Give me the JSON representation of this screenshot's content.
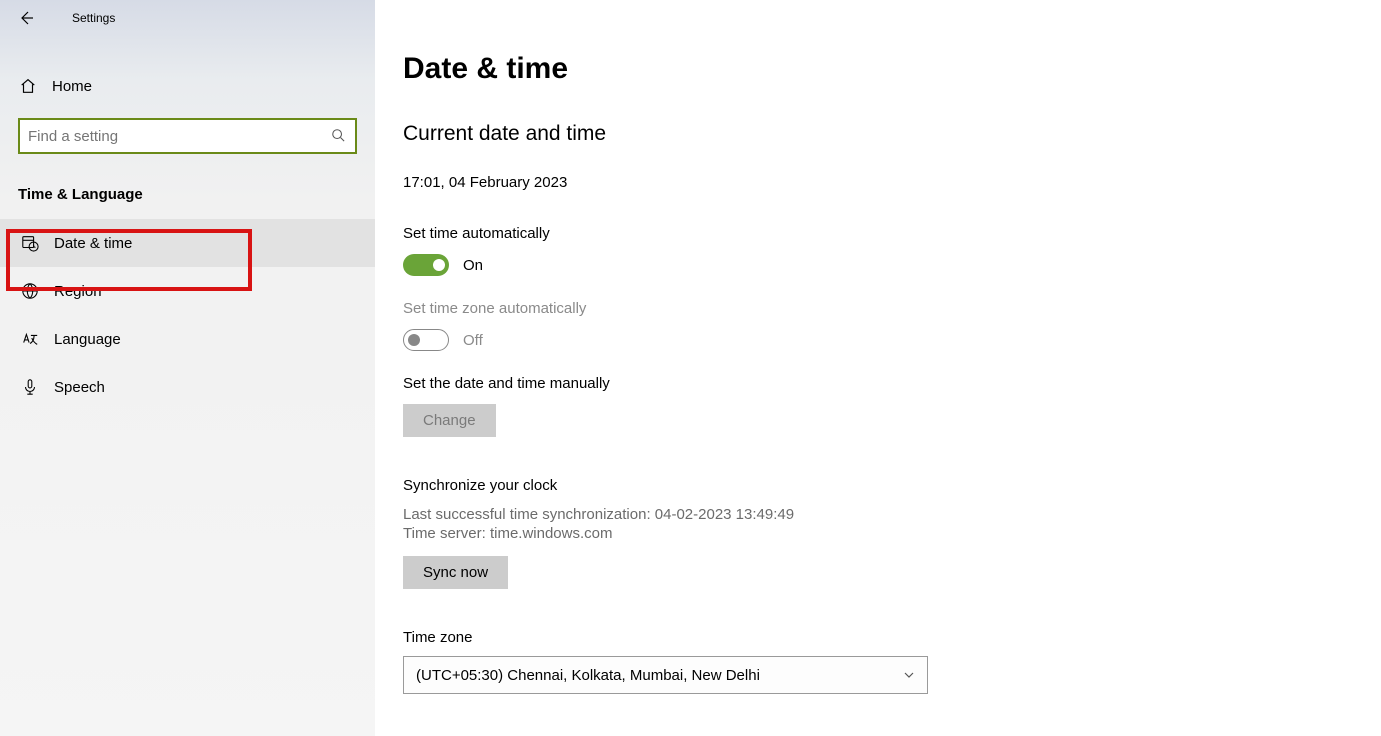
{
  "window": {
    "title": "Settings"
  },
  "sidebar": {
    "home": "Home",
    "search_placeholder": "Find a setting",
    "category": "Time & Language",
    "items": [
      {
        "label": "Date & time"
      },
      {
        "label": "Region"
      },
      {
        "label": "Language"
      },
      {
        "label": "Speech"
      }
    ]
  },
  "main": {
    "title": "Date & time",
    "section1_title": "Current date and time",
    "current_datetime": "17:01, 04 February 2023",
    "set_time_auto_label": "Set time automatically",
    "set_time_auto_state": "On",
    "set_tz_auto_label": "Set time zone automatically",
    "set_tz_auto_state": "Off",
    "set_manual_label": "Set the date and time manually",
    "change_btn": "Change",
    "sync_title": "Synchronize your clock",
    "sync_last": "Last successful time synchronization: 04-02-2023 13:49:49",
    "sync_server": "Time server: time.windows.com",
    "sync_btn": "Sync now",
    "tz_label": "Time zone",
    "tz_value": "(UTC+05:30) Chennai, Kolkata, Mumbai, New Delhi"
  }
}
